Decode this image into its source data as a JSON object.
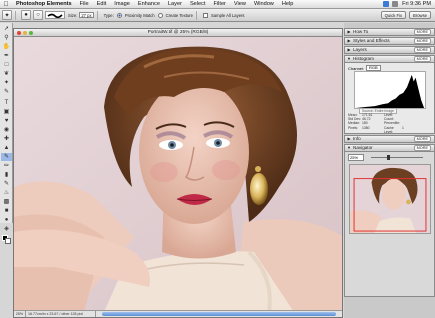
{
  "menubar": {
    "app": "Photoshop Elements",
    "items": [
      "File",
      "Edit",
      "Image",
      "Enhance",
      "Layer",
      "Select",
      "Filter",
      "View",
      "Window",
      "Help"
    ],
    "clock": "Fri 9:36 PM",
    "quickfix": "Quick Fix",
    "browse": "Browse"
  },
  "options": {
    "size_label": "Size:",
    "size_value": "27 px",
    "type_label": "Type:",
    "proximity_label": "Proximity Match",
    "texture_label": "Create Texture",
    "sample_label": "Sample All Layers",
    "help_placeholder": "Type a question for help"
  },
  "document": {
    "title": "PortraitW.tif @ 25% (RGB/8)",
    "zoom": "25%",
    "info": "16.77cm/in x 23.67 / other 128 pixl"
  },
  "palettes": {
    "tabs": [
      {
        "label": "How To",
        "more": "MORE"
      },
      {
        "label": "Styles and Effects",
        "more": "MORE"
      },
      {
        "label": "Layers",
        "more": "MORE"
      },
      {
        "label": "Histogram",
        "more": "MORE"
      },
      {
        "label": "Info",
        "more": "MORE"
      },
      {
        "label": "Navigator",
        "more": "MORE"
      }
    ],
    "histogram": {
      "channel_label": "Channel:",
      "channel_value": "RGB",
      "source": "Source: Entire Image",
      "stats": [
        {
          "k": "Mean:",
          "v": "171.61",
          "k2": "Level:",
          "v2": ""
        },
        {
          "k": "Std Dev:",
          "v": "46.72",
          "k2": "Count:",
          "v2": ""
        },
        {
          "k": "Median:",
          "v": "180",
          "k2": "Percentile:",
          "v2": ""
        },
        {
          "k": "Pixels:",
          "v": "1380",
          "k2": "Cache Level:",
          "v2": "1"
        }
      ]
    },
    "navigator": {
      "zoom": "25%"
    }
  },
  "colors": {
    "accent": "#2a5fd0",
    "backdrop": "#e4d3d7",
    "hair": "#6a3f22"
  }
}
